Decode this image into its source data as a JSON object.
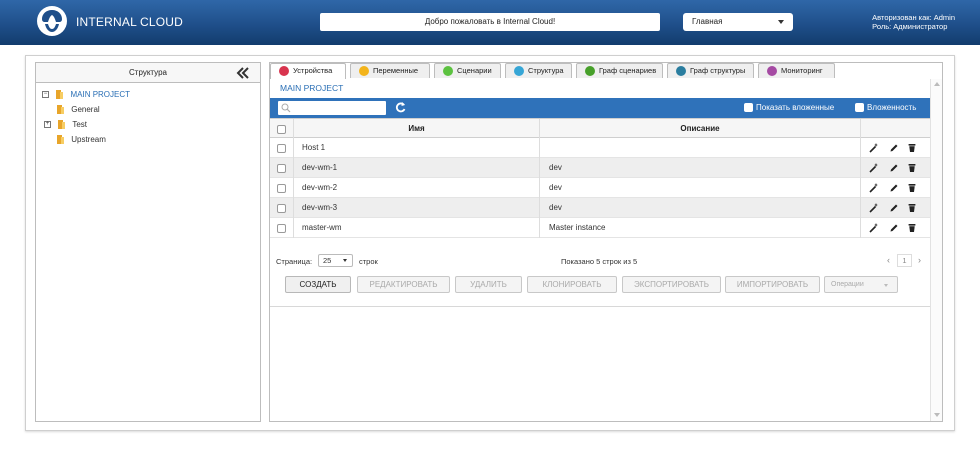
{
  "header": {
    "brand": "INTERNAL CLOUD",
    "welcome": "Добро пожаловать в Internal Cloud!",
    "nav_select": "Главная",
    "auth_line1": "Авторизован как: Admin",
    "auth_line2": "Роль: Администратор"
  },
  "sidebar": {
    "title": "Структура",
    "tree": [
      {
        "label": "MAIN PROJECT",
        "toggle": "−"
      },
      {
        "label": "General"
      },
      {
        "label": "Test",
        "toggle": "+"
      },
      {
        "label": "Upstream"
      }
    ]
  },
  "tabs": [
    {
      "label": "Устройства",
      "color": "#d8344e"
    },
    {
      "label": "Переменные",
      "color": "#f3b41b"
    },
    {
      "label": "Сценарии",
      "color": "#5cc240"
    },
    {
      "label": "Структура",
      "color": "#36a6d6"
    },
    {
      "label": "Граф сценариев",
      "color": "#47a02a"
    },
    {
      "label": "Граф структуры",
      "color": "#2a7d9f"
    },
    {
      "label": "Мониторинг",
      "color": "#a54aa3"
    }
  ],
  "breadcrumb": "MAIN PROJECT",
  "toolbar": {
    "search_placeholder": "",
    "show_nested": "Показать вложенные",
    "nesting": "Вложенность"
  },
  "table": {
    "headers": {
      "name": "Имя",
      "description": "Описание"
    },
    "rows": [
      {
        "name": "Host 1",
        "description": ""
      },
      {
        "name": "dev-wm-1",
        "description": "dev"
      },
      {
        "name": "dev-wm-2",
        "description": "dev"
      },
      {
        "name": "dev-wm-3",
        "description": "dev"
      },
      {
        "name": "master-wm",
        "description": "Master instance"
      }
    ]
  },
  "pager": {
    "page_label": "Страница:",
    "page_size": "25",
    "rows_label": "строк",
    "info": "Показано 5 строк из 5",
    "prev": "‹",
    "current": "1",
    "next": "›"
  },
  "actions": {
    "create": "СОЗДАТЬ",
    "edit": "РЕДАКТИРОВАТЬ",
    "delete": "УДАЛИТЬ",
    "clone": "КЛОНИРОВАТЬ",
    "export": "ЭКСПОРТИРОВАТЬ",
    "import": "ИМПОРТИРОВАТЬ",
    "operations": "Операции"
  },
  "colors": {
    "header": "#1f4f8a",
    "toolbar": "#2f72ba",
    "link": "#2a6fb5"
  }
}
